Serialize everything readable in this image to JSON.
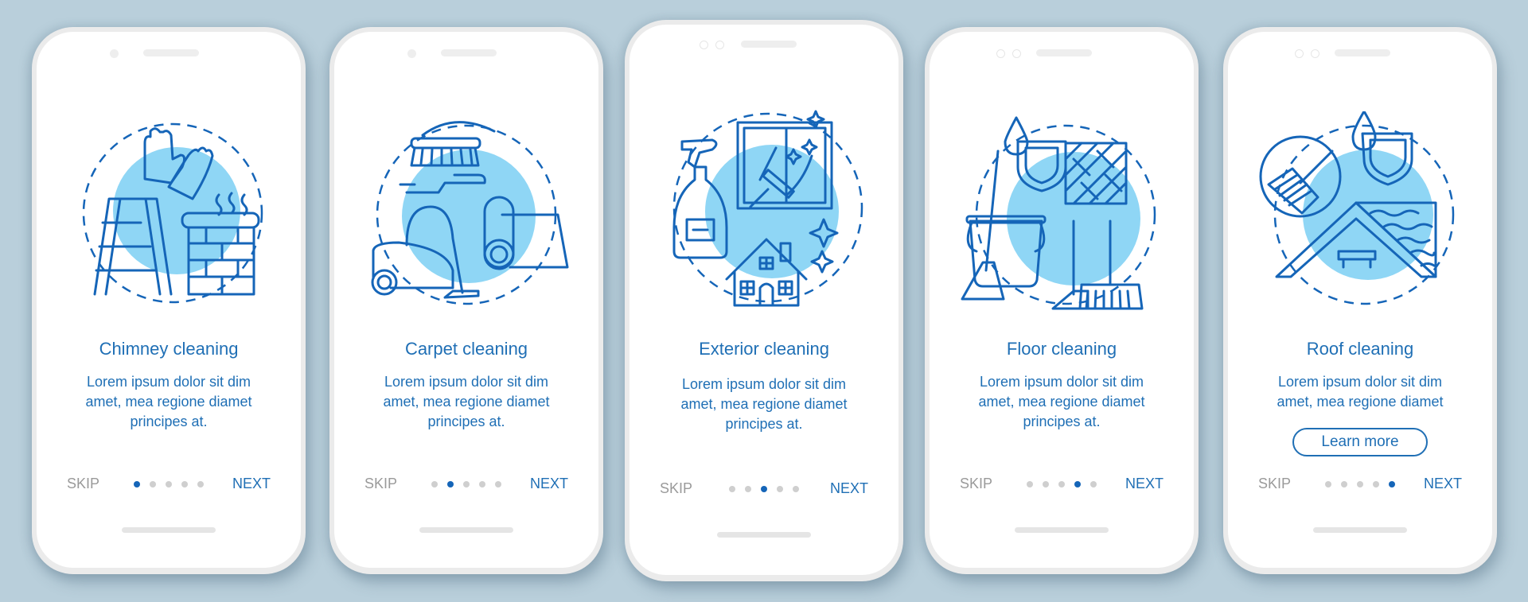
{
  "colors": {
    "background": "#b9cfdb",
    "accent": "#1f6fb5",
    "active_dot": "#1565b8",
    "inactive_dot": "#cfcfcf",
    "skip": "#9a9a9a",
    "illustration_circle": "#8fd6f5"
  },
  "screens": [
    {
      "title": "Chimney cleaning",
      "body": [
        "Lorem ipsum dolor sit dim",
        "amet, mea regione diamet",
        "principes at."
      ],
      "illustration": "chimney-cleaning-illustration",
      "skip": "SKIP",
      "next": "NEXT",
      "page_index": 1,
      "page_count": 5
    },
    {
      "title": "Carpet cleaning",
      "body": [
        "Lorem ipsum dolor sit dim",
        "amet, mea regione diamet",
        "principes at."
      ],
      "illustration": "carpet-cleaning-illustration",
      "skip": "SKIP",
      "next": "NEXT",
      "page_index": 2,
      "page_count": 5
    },
    {
      "title": "Exterior cleaning",
      "body": [
        "Lorem ipsum dolor sit dim",
        "amet, mea regione diamet",
        "principes at."
      ],
      "illustration": "exterior-cleaning-illustration",
      "skip": "SKIP",
      "next": "NEXT",
      "page_index": 3,
      "page_count": 5
    },
    {
      "title": "Floor cleaning",
      "body": [
        "Lorem ipsum dolor sit dim",
        "amet, mea regione diamet",
        "principes at."
      ],
      "illustration": "floor-cleaning-illustration",
      "skip": "SKIP",
      "next": "NEXT",
      "page_index": 4,
      "page_count": 5
    },
    {
      "title": "Roof cleaning",
      "body": [
        "Lorem ipsum dolor sit dim",
        "amet, mea regione diamet"
      ],
      "illustration": "roof-cleaning-illustration",
      "button": "Learn more",
      "skip": "SKIP",
      "next": "NEXT",
      "page_index": 5,
      "page_count": 5
    }
  ]
}
